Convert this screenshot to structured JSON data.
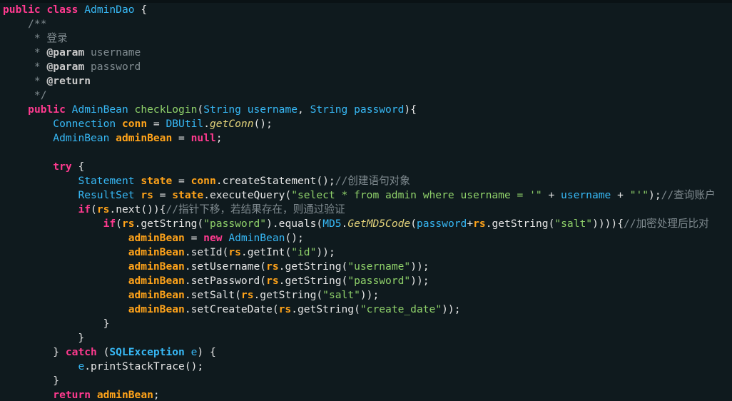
{
  "lines": [
    [
      {
        "t": "public",
        "c": "kw"
      },
      {
        "t": " ",
        "c": "pl"
      },
      {
        "t": "class",
        "c": "kw"
      },
      {
        "t": " ",
        "c": "pl"
      },
      {
        "t": "AdminDao",
        "c": "ty"
      },
      {
        "t": " {",
        "c": "pl"
      }
    ],
    [
      {
        "t": "    /**",
        "c": "cm"
      }
    ],
    [
      {
        "t": "     * 登录",
        "c": "cm"
      }
    ],
    [
      {
        "t": "     * ",
        "c": "cm"
      },
      {
        "t": "@param",
        "c": "jdtag"
      },
      {
        "t": " username",
        "c": "cm"
      }
    ],
    [
      {
        "t": "     * ",
        "c": "cm"
      },
      {
        "t": "@param",
        "c": "jdtag"
      },
      {
        "t": " password",
        "c": "cm"
      }
    ],
    [
      {
        "t": "     * ",
        "c": "cm"
      },
      {
        "t": "@return",
        "c": "jdtag"
      }
    ],
    [
      {
        "t": "     */",
        "c": "cm"
      }
    ],
    [
      {
        "t": "    ",
        "c": "pl"
      },
      {
        "t": "public",
        "c": "kw"
      },
      {
        "t": " ",
        "c": "pl"
      },
      {
        "t": "AdminBean",
        "c": "ty"
      },
      {
        "t": " ",
        "c": "pl"
      },
      {
        "t": "checkLogin",
        "c": "fld"
      },
      {
        "t": "(",
        "c": "pl"
      },
      {
        "t": "String",
        "c": "ty"
      },
      {
        "t": " ",
        "c": "pl"
      },
      {
        "t": "username",
        "c": "par"
      },
      {
        "t": ", ",
        "c": "pl"
      },
      {
        "t": "String",
        "c": "ty"
      },
      {
        "t": " ",
        "c": "pl"
      },
      {
        "t": "password",
        "c": "par"
      },
      {
        "t": "){",
        "c": "pl"
      }
    ],
    [
      {
        "t": "        ",
        "c": "pl"
      },
      {
        "t": "Connection",
        "c": "ty"
      },
      {
        "t": " ",
        "c": "pl"
      },
      {
        "t": "conn",
        "c": "loc"
      },
      {
        "t": " = ",
        "c": "pl"
      },
      {
        "t": "DBUtil",
        "c": "ty"
      },
      {
        "t": ".",
        "c": "pl"
      },
      {
        "t": "getConn",
        "c": "st"
      },
      {
        "t": "();",
        "c": "pl"
      }
    ],
    [
      {
        "t": "        ",
        "c": "pl"
      },
      {
        "t": "AdminBean",
        "c": "ty"
      },
      {
        "t": " ",
        "c": "pl"
      },
      {
        "t": "adminBean",
        "c": "loc"
      },
      {
        "t": " = ",
        "c": "pl"
      },
      {
        "t": "null",
        "c": "nul"
      },
      {
        "t": ";",
        "c": "pl"
      }
    ],
    [
      {
        "t": "",
        "c": "pl"
      }
    ],
    [
      {
        "t": "        ",
        "c": "pl"
      },
      {
        "t": "try",
        "c": "kw"
      },
      {
        "t": " {",
        "c": "pl"
      }
    ],
    [
      {
        "t": "            ",
        "c": "pl"
      },
      {
        "t": "Statement",
        "c": "ty"
      },
      {
        "t": " ",
        "c": "pl"
      },
      {
        "t": "state",
        "c": "loc"
      },
      {
        "t": " = ",
        "c": "pl"
      },
      {
        "t": "conn",
        "c": "loc"
      },
      {
        "t": ".",
        "c": "pl"
      },
      {
        "t": "createStatement",
        "c": "mth"
      },
      {
        "t": "();",
        "c": "pl"
      },
      {
        "t": "//创建语句对象",
        "c": "cm"
      }
    ],
    [
      {
        "t": "            ",
        "c": "pl"
      },
      {
        "t": "ResultSet",
        "c": "ty"
      },
      {
        "t": " ",
        "c": "pl"
      },
      {
        "t": "rs",
        "c": "loc"
      },
      {
        "t": " = ",
        "c": "pl"
      },
      {
        "t": "state",
        "c": "loc"
      },
      {
        "t": ".",
        "c": "pl"
      },
      {
        "t": "executeQuery",
        "c": "mth"
      },
      {
        "t": "(",
        "c": "pl"
      },
      {
        "t": "\"select * from admin where username = '\"",
        "c": "str"
      },
      {
        "t": " + ",
        "c": "pl"
      },
      {
        "t": "username",
        "c": "par"
      },
      {
        "t": " + ",
        "c": "pl"
      },
      {
        "t": "\"'\"",
        "c": "str"
      },
      {
        "t": ");",
        "c": "pl"
      },
      {
        "t": "//查询账户",
        "c": "cm"
      }
    ],
    [
      {
        "t": "            ",
        "c": "pl"
      },
      {
        "t": "if",
        "c": "kw"
      },
      {
        "t": "(",
        "c": "pl"
      },
      {
        "t": "rs",
        "c": "loc"
      },
      {
        "t": ".",
        "c": "pl"
      },
      {
        "t": "next",
        "c": "mth"
      },
      {
        "t": "()){",
        "c": "pl"
      },
      {
        "t": "//指针下移，若结果存在，则通过验证",
        "c": "cm"
      }
    ],
    [
      {
        "t": "                ",
        "c": "pl"
      },
      {
        "t": "if",
        "c": "kw"
      },
      {
        "t": "(",
        "c": "pl"
      },
      {
        "t": "rs",
        "c": "loc"
      },
      {
        "t": ".",
        "c": "pl"
      },
      {
        "t": "getString",
        "c": "mth"
      },
      {
        "t": "(",
        "c": "pl"
      },
      {
        "t": "\"password\"",
        "c": "str"
      },
      {
        "t": ").",
        "c": "pl"
      },
      {
        "t": "equals",
        "c": "mth"
      },
      {
        "t": "(",
        "c": "pl"
      },
      {
        "t": "MD5",
        "c": "ty"
      },
      {
        "t": ".",
        "c": "pl"
      },
      {
        "t": "GetMD5Code",
        "c": "st"
      },
      {
        "t": "(",
        "c": "pl"
      },
      {
        "t": "password",
        "c": "par"
      },
      {
        "t": "+",
        "c": "pl"
      },
      {
        "t": "rs",
        "c": "loc"
      },
      {
        "t": ".",
        "c": "pl"
      },
      {
        "t": "getString",
        "c": "mth"
      },
      {
        "t": "(",
        "c": "pl"
      },
      {
        "t": "\"salt\"",
        "c": "str"
      },
      {
        "t": ")))){",
        "c": "pl"
      },
      {
        "t": "//加密处理后比对",
        "c": "cm"
      }
    ],
    [
      {
        "t": "                    ",
        "c": "pl"
      },
      {
        "t": "adminBean",
        "c": "loc"
      },
      {
        "t": " = ",
        "c": "pl"
      },
      {
        "t": "new",
        "c": "kw"
      },
      {
        "t": " ",
        "c": "pl"
      },
      {
        "t": "AdminBean",
        "c": "ty"
      },
      {
        "t": "();",
        "c": "pl"
      }
    ],
    [
      {
        "t": "                    ",
        "c": "pl"
      },
      {
        "t": "adminBean",
        "c": "loc"
      },
      {
        "t": ".",
        "c": "pl"
      },
      {
        "t": "setId",
        "c": "mth"
      },
      {
        "t": "(",
        "c": "pl"
      },
      {
        "t": "rs",
        "c": "loc"
      },
      {
        "t": ".",
        "c": "pl"
      },
      {
        "t": "getInt",
        "c": "mth"
      },
      {
        "t": "(",
        "c": "pl"
      },
      {
        "t": "\"id\"",
        "c": "str"
      },
      {
        "t": "));",
        "c": "pl"
      }
    ],
    [
      {
        "t": "                    ",
        "c": "pl"
      },
      {
        "t": "adminBean",
        "c": "loc"
      },
      {
        "t": ".",
        "c": "pl"
      },
      {
        "t": "setUsername",
        "c": "mth"
      },
      {
        "t": "(",
        "c": "pl"
      },
      {
        "t": "rs",
        "c": "loc"
      },
      {
        "t": ".",
        "c": "pl"
      },
      {
        "t": "getString",
        "c": "mth"
      },
      {
        "t": "(",
        "c": "pl"
      },
      {
        "t": "\"username\"",
        "c": "str"
      },
      {
        "t": "));",
        "c": "pl"
      }
    ],
    [
      {
        "t": "                    ",
        "c": "pl"
      },
      {
        "t": "adminBean",
        "c": "loc"
      },
      {
        "t": ".",
        "c": "pl"
      },
      {
        "t": "setPassword",
        "c": "mth"
      },
      {
        "t": "(",
        "c": "pl"
      },
      {
        "t": "rs",
        "c": "loc"
      },
      {
        "t": ".",
        "c": "pl"
      },
      {
        "t": "getString",
        "c": "mth"
      },
      {
        "t": "(",
        "c": "pl"
      },
      {
        "t": "\"password\"",
        "c": "str"
      },
      {
        "t": "));",
        "c": "pl"
      }
    ],
    [
      {
        "t": "                    ",
        "c": "pl"
      },
      {
        "t": "adminBean",
        "c": "loc"
      },
      {
        "t": ".",
        "c": "pl"
      },
      {
        "t": "setSalt",
        "c": "mth"
      },
      {
        "t": "(",
        "c": "pl"
      },
      {
        "t": "rs",
        "c": "loc"
      },
      {
        "t": ".",
        "c": "pl"
      },
      {
        "t": "getString",
        "c": "mth"
      },
      {
        "t": "(",
        "c": "pl"
      },
      {
        "t": "\"salt\"",
        "c": "str"
      },
      {
        "t": "));",
        "c": "pl"
      }
    ],
    [
      {
        "t": "                    ",
        "c": "pl"
      },
      {
        "t": "adminBean",
        "c": "loc"
      },
      {
        "t": ".",
        "c": "pl"
      },
      {
        "t": "setCreateDate",
        "c": "mth"
      },
      {
        "t": "(",
        "c": "pl"
      },
      {
        "t": "rs",
        "c": "loc"
      },
      {
        "t": ".",
        "c": "pl"
      },
      {
        "t": "getString",
        "c": "mth"
      },
      {
        "t": "(",
        "c": "pl"
      },
      {
        "t": "\"create_date\"",
        "c": "str"
      },
      {
        "t": "));",
        "c": "pl"
      }
    ],
    [
      {
        "t": "                }",
        "c": "pl"
      }
    ],
    [
      {
        "t": "            }",
        "c": "pl"
      }
    ],
    [
      {
        "t": "        } ",
        "c": "pl"
      },
      {
        "t": "catch",
        "c": "kw"
      },
      {
        "t": " (",
        "c": "pl"
      },
      {
        "t": "SQLException",
        "c": "tyb"
      },
      {
        "t": " ",
        "c": "pl"
      },
      {
        "t": "e",
        "c": "par"
      },
      {
        "t": ") {",
        "c": "pl"
      }
    ],
    [
      {
        "t": "            ",
        "c": "pl"
      },
      {
        "t": "e",
        "c": "par"
      },
      {
        "t": ".",
        "c": "pl"
      },
      {
        "t": "printStackTrace",
        "c": "mth"
      },
      {
        "t": "();",
        "c": "pl"
      }
    ],
    [
      {
        "t": "        }",
        "c": "pl"
      }
    ],
    [
      {
        "t": "        ",
        "c": "pl"
      },
      {
        "t": "return",
        "c": "kw"
      },
      {
        "t": " ",
        "c": "pl"
      },
      {
        "t": "adminBean",
        "c": "loc"
      },
      {
        "t": ";",
        "c": "pl"
      }
    ]
  ]
}
